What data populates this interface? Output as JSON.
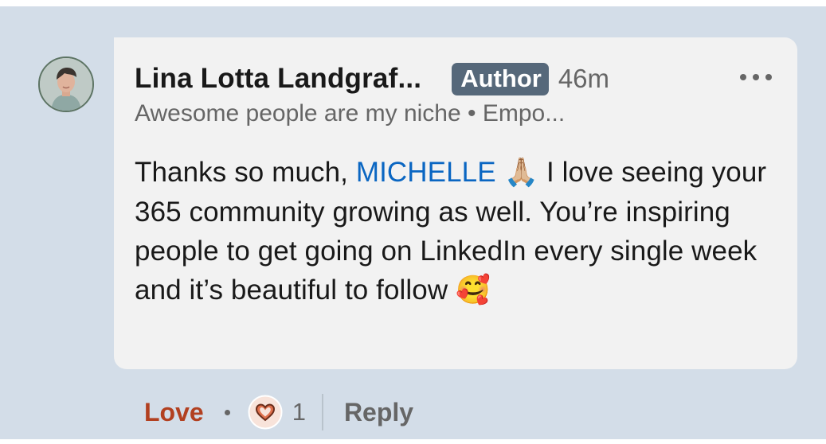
{
  "comment": {
    "author_name": "Lina Lotta Landgraf...",
    "author_badge": "Author",
    "timestamp": "46m",
    "headline": "Awesome people are my niche • Empo...",
    "text_before_mention": "Thanks so much, ",
    "mention": "MICHELLE",
    "emoji_pray": "🙏🏼",
    "text_after_mention": " I love seeing your 365 community growing as well. You’re inspiring people to get going on LinkedIn every single week and it’s beautiful to follow ",
    "emoji_hearts": "🥰",
    "more_icon": "ellipsis-icon"
  },
  "actions": {
    "love_label": "Love",
    "reaction_icon": "heart-reaction-icon",
    "reaction_count": "1",
    "reply_label": "Reply"
  },
  "colors": {
    "background": "#d3dde8",
    "bubble": "#f2f2f2",
    "mention": "#0a66c2",
    "love": "#b24020",
    "badge": "#56687a",
    "heart": "#df704d"
  }
}
